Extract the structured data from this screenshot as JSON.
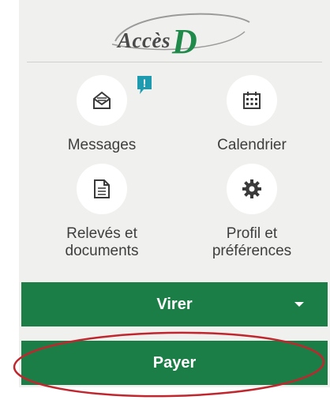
{
  "logo": {
    "prefix": "Accès",
    "letter": "D"
  },
  "tiles": [
    {
      "label": "Messages",
      "icon": "envelope-icon"
    },
    {
      "label": "Calendrier",
      "icon": "calendar-icon"
    },
    {
      "label": "Relevés et documents",
      "icon": "document-icon"
    },
    {
      "label": "Profil et préférences",
      "icon": "gear-icon"
    }
  ],
  "notification_badge": {
    "text": "!"
  },
  "buttons": {
    "virer": "Virer",
    "payer": "Payer"
  },
  "colors": {
    "brand_green": "#1b7e47",
    "badge_teal": "#1f9bb0",
    "highlight_red": "#c0262d"
  }
}
